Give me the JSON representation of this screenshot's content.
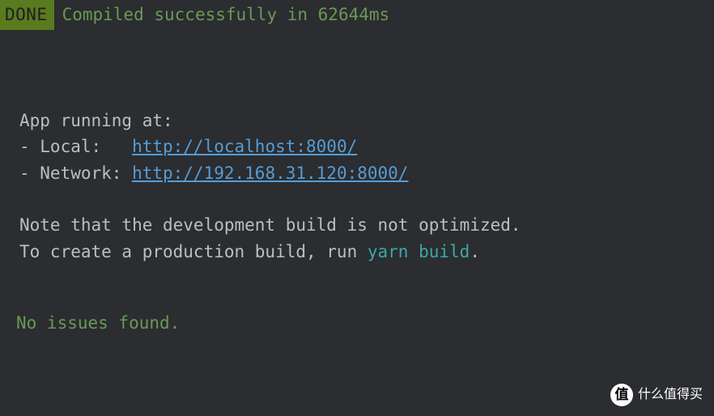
{
  "status": {
    "badge": "DONE",
    "message": " Compiled successfully in 62644ms"
  },
  "app": {
    "heading": "App running at:",
    "local_prefix": "- Local:   ",
    "local_url": "http://localhost:8000/",
    "network_prefix": "- Network: ",
    "network_url": "http://192.168.31.120:8000/"
  },
  "note": {
    "line1": "Note that the development build is not optimized.",
    "line2_pre": "To create a production build, run ",
    "line2_cmd": "yarn build",
    "line2_post": "."
  },
  "issues": "No issues found.",
  "watermark": {
    "icon": "值",
    "text": "什么值得买"
  }
}
